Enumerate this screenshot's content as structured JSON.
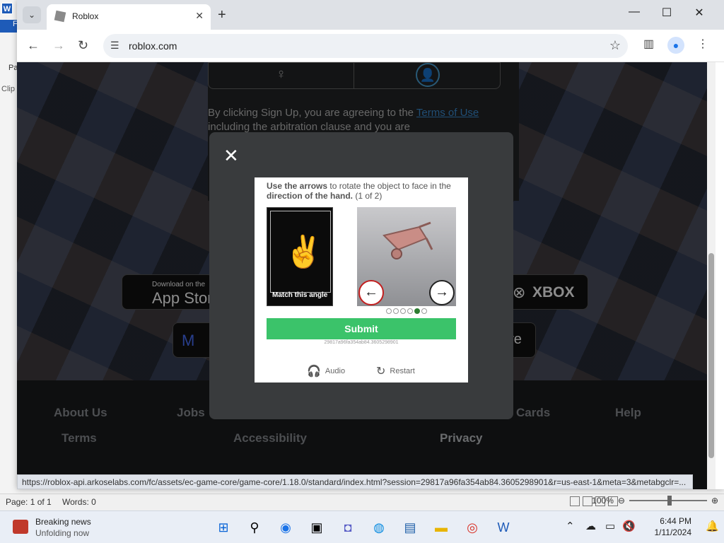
{
  "word": {
    "icon_letter": "W",
    "ribbon_tab": "F",
    "paste_label": "Pa",
    "clip_label": "Clip",
    "status": {
      "page": "Page: 1 of 1",
      "words": "Words: 0",
      "zoom": "100%"
    }
  },
  "browser": {
    "tab_title": "Roblox",
    "url": "roblox.com",
    "status_url": "https://roblox-api.arkoselabs.com/fc/assets/ec-game-core/game-core/1.18.0/standard/index.html?session=29817a96fa354ab84.3605298901&r=us-east-1&meta=3&metabgclr=..."
  },
  "page": {
    "terms_prefix": "By clicking Sign Up, you are agreeing to the ",
    "terms_link": "Terms of Use",
    "terms_suffix": " including the arbitration clause and you are",
    "appstore_small": "Download on the",
    "appstore_big": "App Stor",
    "xbox_label": "XBOX",
    "meta_label": "M",
    "store_partial": "ore",
    "footer_links": [
      "About Us",
      "Jobs",
      "Cards",
      "Help",
      "Terms",
      "Accessibility",
      "Privacy"
    ]
  },
  "captcha": {
    "instruction_1": "Use the arrows",
    "instruction_2": " to rotate the object",
    "instruction_3": " to face in the ",
    "instruction_4": "direction of the hand.",
    "instruction_5": " (1 of 2)",
    "match_caption": "Match this angle",
    "submit_label": "Submit",
    "session_id": "29817a96fa354ab84.3605298901",
    "audio_label": "Audio",
    "restart_label": "Restart",
    "progress_active_index": 4,
    "progress_total": 6
  },
  "taskbar": {
    "news_title": "Breaking news",
    "news_sub": "Unfolding now",
    "time": "6:44 PM",
    "date": "1/11/2024"
  },
  "colors": {
    "submit_green": "#3bc36a",
    "link_blue": "#3b8ed6",
    "modal_bg": "#393b3d"
  }
}
